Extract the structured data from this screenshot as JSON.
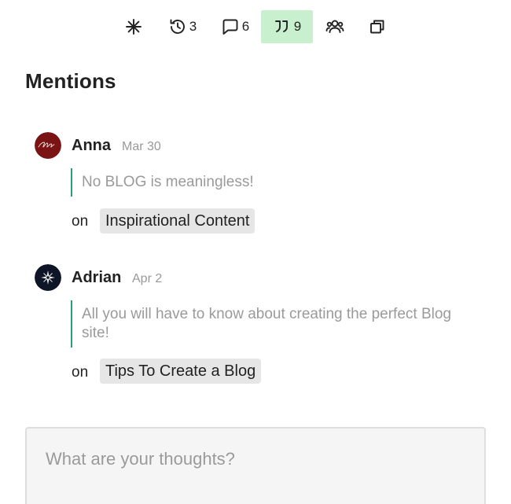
{
  "toolbar": {
    "items": [
      {
        "icon": "sparkle-icon",
        "count": ""
      },
      {
        "icon": "history-icon",
        "count": "3"
      },
      {
        "icon": "comment-icon",
        "count": "6"
      },
      {
        "icon": "quote-icon",
        "count": "9",
        "active": true
      },
      {
        "icon": "people-icon",
        "count": ""
      },
      {
        "icon": "share-icon",
        "count": ""
      }
    ],
    "active_color": "#c8f0cf"
  },
  "page": {
    "title": "Mentions"
  },
  "mentions": [
    {
      "author": "Anna",
      "date": "Mar 30",
      "quote": "No BLOG is meaningless!",
      "on_label": "on",
      "post": "Inspirational Content",
      "avatar_color": "#7a1414"
    },
    {
      "author": "Adrian",
      "date": "Apr 2",
      "quote": "All you will have to know about creating the perfect Blog site!",
      "on_label": "on",
      "post": "Tips To Create a Blog",
      "avatar_color": "#0e1526"
    }
  ],
  "composer": {
    "placeholder": "What are your thoughts?"
  },
  "colors": {
    "quote_border": "#2a9d7c",
    "chip_bg": "#e6e6e6"
  }
}
